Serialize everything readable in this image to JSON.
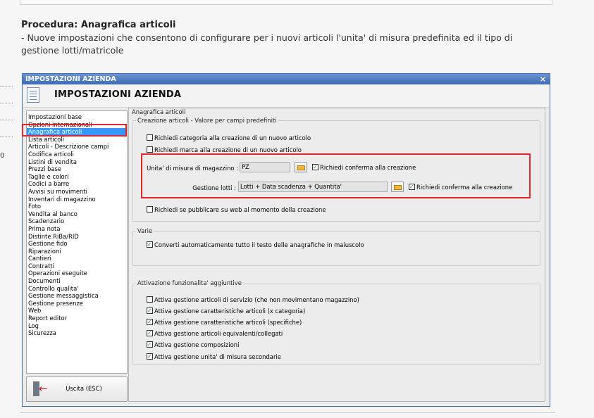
{
  "doc": {
    "title": "Procedura: Anagrafica articoli",
    "description": "- Nuove impostazioni che consentono di configurare per i nuovi articoli l'unita' di misura predefinita ed il tipo di gestione lotti/matricole",
    "gutter_text": "0"
  },
  "window": {
    "titlebar": "IMPOSTAZIONI AZIENDA",
    "close_label": "×",
    "header_title": "IMPOSTAZIONI AZIENDA",
    "exit_label": "Uscita (ESC)"
  },
  "nav": {
    "items": [
      "Impostazioni base",
      "Opzioni internazionali",
      "Anagrafica articoli",
      "Lista articoli",
      "Articoli - Descrizione campi",
      "Codifica articoli",
      "Listini di vendita",
      "Prezzi base",
      "Taglie e colori",
      "Codici a barre",
      "Avvisi su movimenti",
      "Inventari di magazzino",
      "Foto",
      "Vendita al banco",
      "Scadenzario",
      "Prima nota",
      "Distinte RiBa/RID",
      "Gestione fido",
      "Riparazioni",
      "Cantieri",
      "Contratti",
      "Operazioni eseguite",
      "Documenti",
      "Controllo qualita'",
      "Gestione messaggistica",
      "Gestione presenze",
      "Web",
      "Report editor",
      "Log",
      "Sicurezza"
    ],
    "selected_index": 2
  },
  "panel": {
    "section_title": "Anagrafica articoli",
    "group1": {
      "title": "Creazione articoli - Valore per campi predefiniti",
      "chk_categoria": "Richiedi categoria alla creazione di un nuovo articolo",
      "chk_marca": "Richiedi marca alla creazione di un nuovo articolo",
      "um_label": "Unita' di misura di magazzino :",
      "um_value": "PZ",
      "um_confirm": "Richiedi conferma alla creazione",
      "lotti_label": "Gestione lotti :",
      "lotti_value": "Lotti + Data scadenza + Quantita'",
      "lotti_confirm": "Richiedi conferma alla creazione",
      "chk_web": "Richiedi se pubblicare su web al momento della creazione"
    },
    "group2": {
      "title": "Varie",
      "chk_maiuscolo": "Converti automaticamente tutto il testo delle anagrafiche in maiuscolo"
    },
    "group3": {
      "title": "Attivazione funzionalita' aggiuntive",
      "items": [
        "Attiva gestione articoli di servizio (che non movimentano magazzino)",
        "Attiva gestione caratteristiche articoli (x categoria)",
        "Attiva gestione caratteristiche articoli (specifiche)",
        "Attiva gestione articoli equivalenti/collegati",
        "Attiva gestione composizioni",
        "Attiva gestione unita' di misura secondarie"
      ]
    }
  },
  "colors": {
    "titlebar": "#3d6bb3",
    "selection": "#3399ff",
    "highlight": "#e3262b",
    "check": "#1a8a1a"
  }
}
